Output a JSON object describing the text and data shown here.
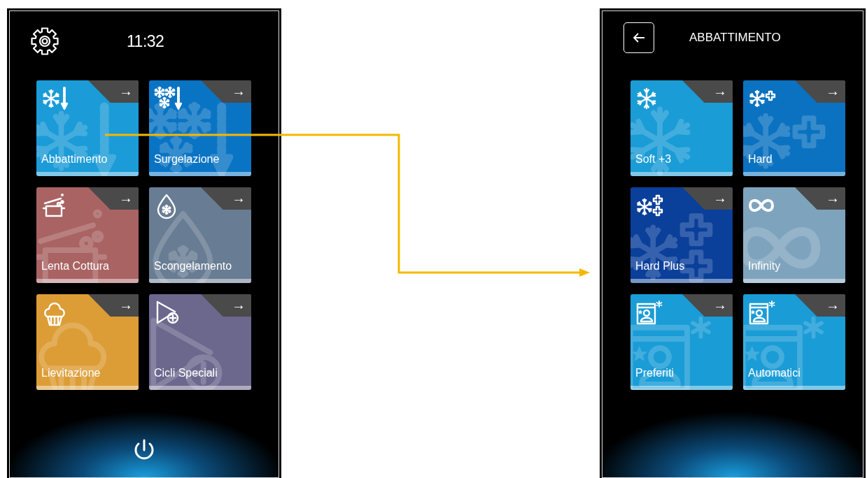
{
  "screens": [
    {
      "kind": "home",
      "time": "11:32",
      "tiles": [
        {
          "label": "Abbattimento",
          "kind": "snowflake-down",
          "color": "#1b9bd7",
          "arrow": "→"
        },
        {
          "label": "Surgelazione",
          "kind": "snowflakes-down",
          "color": "#0a74c4",
          "arrow": "→"
        },
        {
          "label": "Lenta Cottura",
          "kind": "pot",
          "color": "#a96363",
          "arrow": "→"
        },
        {
          "label": "Scongelamento",
          "kind": "drop",
          "color": "#687c93",
          "arrow": "→"
        },
        {
          "label": "Lievitazione",
          "kind": "muffin",
          "color": "#dc9d36",
          "arrow": "→"
        },
        {
          "label": "Cicli Speciali",
          "kind": "play-plus",
          "color": "#6c678d",
          "arrow": "→"
        }
      ]
    },
    {
      "kind": "submenu",
      "title": "ABBATTIMENTO",
      "tiles": [
        {
          "label": "Soft +3",
          "kind": "snowflake",
          "color": "#1a9cd6",
          "arrow": "→"
        },
        {
          "label": "Hard",
          "kind": "snowflake-plus",
          "color": "#0a72c0",
          "arrow": "→"
        },
        {
          "label": "Hard Plus",
          "kind": "snowflake-plusplus",
          "color": "#0a3f9a",
          "arrow": "→"
        },
        {
          "label": "Infinity",
          "kind": "infinity",
          "color": "#7ea3bd",
          "arrow": "→"
        },
        {
          "label": "Preferiti",
          "kind": "folder-star",
          "color": "#1a9cd6",
          "arrow": "→"
        },
        {
          "label": "Automatici",
          "kind": "folder-star",
          "color": "#1a9cd6",
          "arrow": "→"
        }
      ]
    }
  ]
}
